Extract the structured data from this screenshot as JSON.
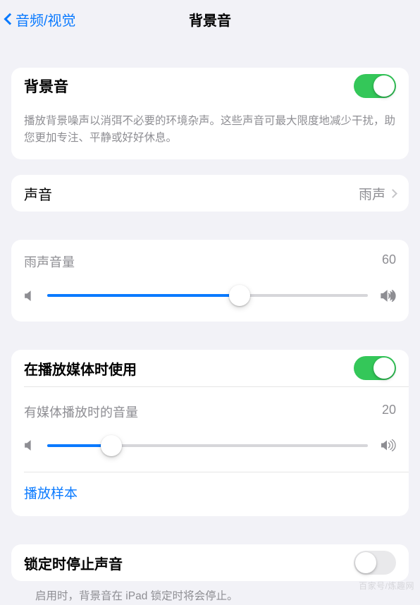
{
  "nav": {
    "back_label": "音频/视觉",
    "title": "背景音"
  },
  "main_toggle": {
    "label": "背景音",
    "on": true,
    "description": "播放背景噪声以消弭不必要的环境杂声。这些声音可最大限度地减少干扰，助您更加专注、平静或好好休息。"
  },
  "sound_row": {
    "label": "声音",
    "value": "雨声"
  },
  "volume1": {
    "label": "雨声音量",
    "value": "60",
    "percent": 60
  },
  "media": {
    "toggle_label": "在播放媒体时使用",
    "toggle_on": true,
    "volume_label": "有媒体播放时的音量",
    "volume_value": "20",
    "volume_percent": 20,
    "sample_label": "播放样本"
  },
  "lock": {
    "label": "锁定时停止声音",
    "on": false,
    "description": "启用时，背景音在 iPad 锁定时将会停止。"
  },
  "watermark": "百家号/炼趣网"
}
